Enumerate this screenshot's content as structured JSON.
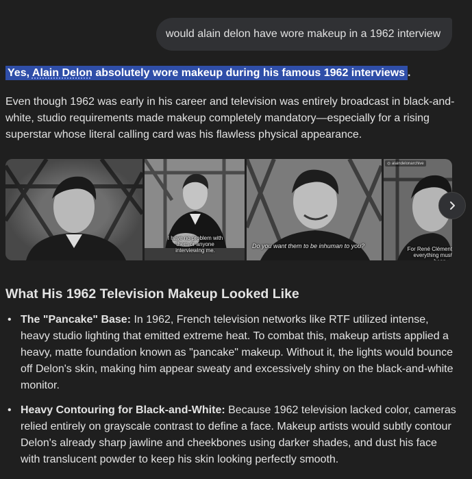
{
  "user_message": "would alain delon have wore makeup in a 1962 interview",
  "answer": {
    "highlight_prefix": "Yes, ",
    "highlight_link": "Alain Delon",
    "highlight_rest": " absolutely wore makeup during his famous 1962 interviews",
    "highlight_end": ".",
    "intro": "Even though 1962 was early in his career and television was entirely broadcast in black-and-white, studio requirements made makeup completely mandatory—especially for a rising superstar whose literal calling card was his flawless physical appearance."
  },
  "carousel": {
    "images": [
      {
        "name": "delon-frame-1",
        "caption": ""
      },
      {
        "name": "delon-frame-2",
        "caption": "I have no problem with them or anyone interviewing me."
      },
      {
        "name": "delon-frame-3",
        "caption": "Do you want them to be inhuman to you?"
      },
      {
        "name": "delon-frame-4",
        "caption": "For René Clément everything must happen",
        "badge": "alaindelonarchive"
      }
    ],
    "next_icon": "chevron-right-icon"
  },
  "section_title": "What His 1962 Television Makeup Looked Like",
  "bullets": [
    {
      "title": "The \"Pancake\" Base:",
      "text": " In 1962, French television networks like RTF utilized intense, heavy studio lighting that emitted extreme heat. To combat this, makeup artists applied a heavy, matte foundation known as \"pancake\" makeup. Without it, the lights would bounce off Delon's skin, making him appear sweaty and excessively shiny on the black-and-white monitor."
    },
    {
      "title": "Heavy Contouring for Black-and-White:",
      "text": " Because 1962 television lacked color, cameras relied entirely on grayscale contrast to define a face. Makeup artists would subtly contour Delon's already sharp jawline and cheekbones using darker shades, and dust his face with translucent powder to keep his skin looking perfectly smooth."
    }
  ],
  "colors": {
    "background": "#1f1f1f",
    "text": "#e3e3e3",
    "highlight": "#2f4ea8",
    "bubble": "#303134"
  }
}
